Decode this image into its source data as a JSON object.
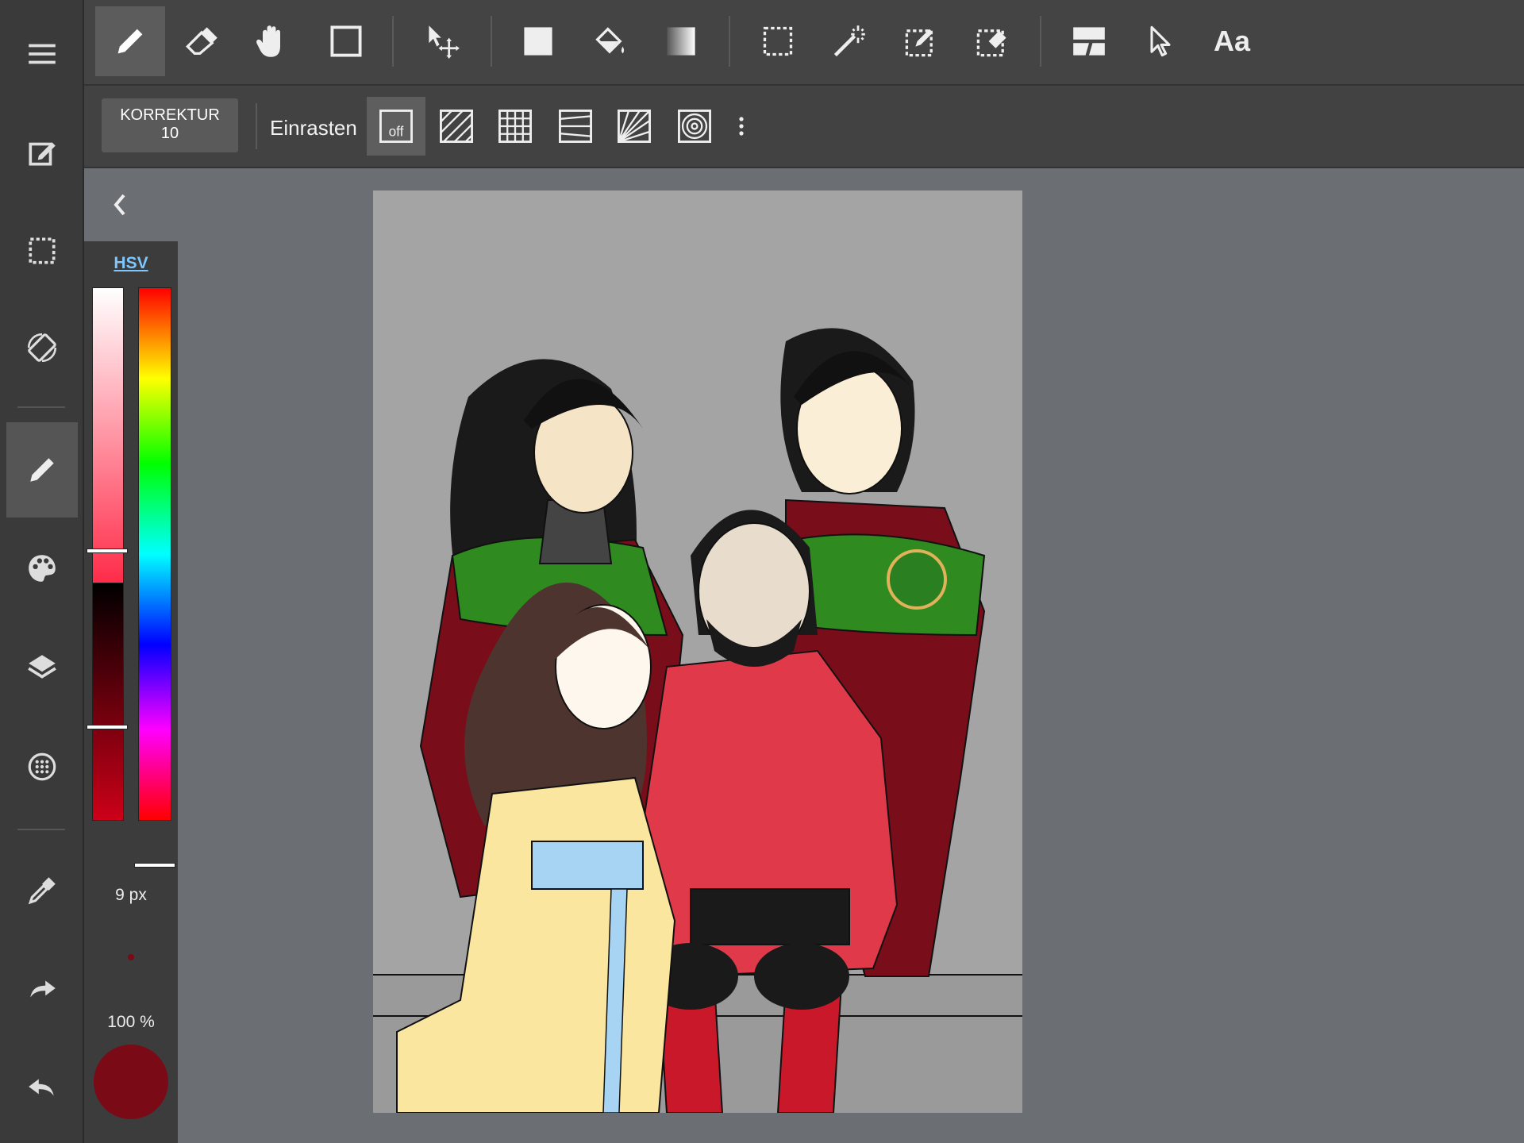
{
  "toolbar": {
    "tools": [
      "pen-tool",
      "eraser-tool",
      "hand-tool",
      "rectangle-tool",
      "move-tool",
      "fill-rect-tool",
      "bucket-tool",
      "gradient-tool",
      "select-rect-tool",
      "magic-wand-tool",
      "select-pen-tool",
      "select-eraser-tool",
      "frame-tool",
      "pointer-tool",
      "text-tool"
    ],
    "active_tool": "pen-tool",
    "text_tool_label": "Aa"
  },
  "subtoolbar": {
    "correction_label": "KORREKTUR",
    "correction_value": "10",
    "snap_label": "Einrasten",
    "snap_off_label": "off",
    "snap_modes": [
      "snap-off",
      "snap-parallel",
      "snap-grid",
      "snap-perspective-lines",
      "snap-radial",
      "snap-concentric"
    ]
  },
  "sidebar": {
    "items": [
      "menu",
      "edit",
      "selection",
      "transform",
      "brush",
      "palette",
      "layers",
      "material",
      "eyedropper",
      "redo",
      "undo"
    ],
    "active_item": "brush"
  },
  "color_panel": {
    "mode_tab": "HSV",
    "brush_size": "9 px",
    "opacity": "100 %",
    "current_color": "#7a0b16"
  },
  "colors": {
    "background": "#6b6e73",
    "canvas": "#a4a4a4",
    "accent": "#7cc7ff"
  }
}
